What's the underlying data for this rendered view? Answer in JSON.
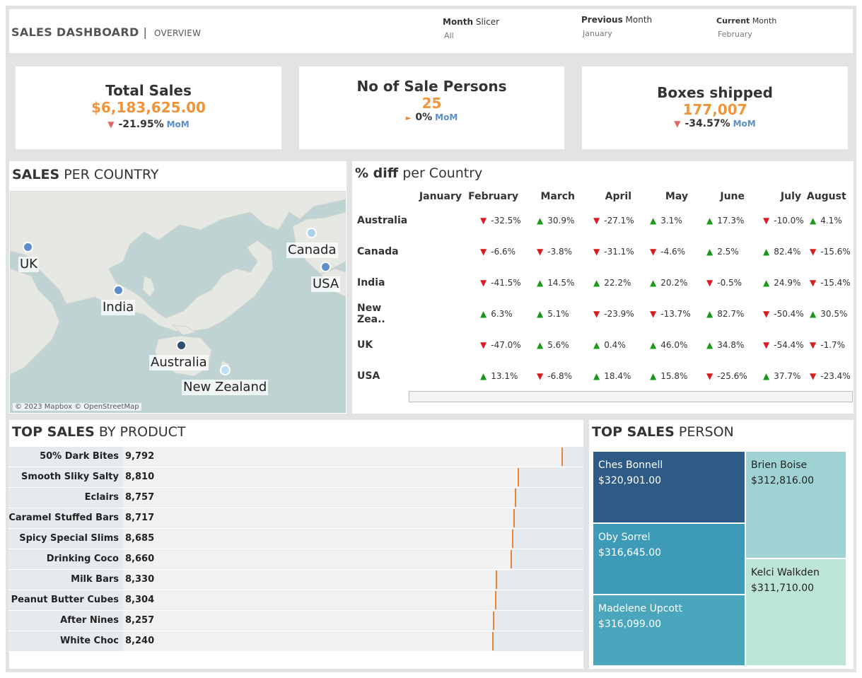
{
  "header": {
    "title": "SALES DASHBOARD",
    "sep": "|",
    "subtitle": "OVERVIEW"
  },
  "slicers": [
    {
      "bold": "Month",
      "label": "Slicer",
      "value": "All"
    },
    {
      "bold": "Previous",
      "label": "Month",
      "value": "January"
    },
    {
      "bold": "Current",
      "label": "Month",
      "value": "February"
    }
  ],
  "kpis": [
    {
      "title": "Total Sales",
      "value": "$6,183,625.00",
      "arrow": "▼",
      "pct": "-21.95%",
      "mom": "MoM"
    },
    {
      "title": "No of Sale Persons",
      "value": "25",
      "arrow": "►",
      "pct": "0%",
      "mom": "MoM"
    },
    {
      "title": "Boxes shipped",
      "value": "177,007",
      "arrow": "▼",
      "pct": "-34.57%",
      "mom": "MoM"
    }
  ],
  "map": {
    "title_bold": "SALES",
    "title_rest": "PER COUNTRY",
    "attribution": "© 2023 Mapbox © OpenStreetMap",
    "points": [
      {
        "name": "UK",
        "color": "#5b8fc7"
      },
      {
        "name": "Canada",
        "color": "#a9d2ec"
      },
      {
        "name": "USA",
        "color": "#5b8fc7"
      },
      {
        "name": "India",
        "color": "#5b8fc7"
      },
      {
        "name": "Australia",
        "color": "#2c4f73"
      },
      {
        "name": "New Zealand",
        "color": "#bcdff1"
      }
    ]
  },
  "diff": {
    "title_bold": "% diff",
    "title_rest": "per Country",
    "months": [
      "January",
      "February",
      "March",
      "April",
      "May",
      "June",
      "July",
      "August"
    ],
    "rows": [
      {
        "country": "Australia",
        "vals": [
          "",
          "-32.5%",
          "30.9%",
          "-27.1%",
          "3.1%",
          "17.3%",
          "-10.0%",
          "4.1%"
        ]
      },
      {
        "country": "Canada",
        "vals": [
          "",
          "-6.6%",
          "-3.8%",
          "-31.1%",
          "-4.6%",
          "2.5%",
          "82.4%",
          "-15.6%"
        ]
      },
      {
        "country": "India",
        "vals": [
          "",
          "-41.5%",
          "14.5%",
          "22.2%",
          "20.2%",
          "-0.5%",
          "24.9%",
          "-15.4%"
        ]
      },
      {
        "country": "New Zea..",
        "vals": [
          "",
          "6.3%",
          "5.1%",
          "-23.9%",
          "-13.7%",
          "82.7%",
          "-50.4%",
          "30.5%"
        ]
      },
      {
        "country": "UK",
        "vals": [
          "",
          "-47.0%",
          "5.6%",
          "0.4%",
          "46.0%",
          "34.8%",
          "-54.4%",
          "-1.7%"
        ]
      },
      {
        "country": "USA",
        "vals": [
          "",
          "13.1%",
          "-6.8%",
          "18.4%",
          "15.8%",
          "-25.6%",
          "37.7%",
          "-23.4%"
        ]
      }
    ]
  },
  "products": {
    "title_bold": "TOP SALES",
    "title_rest": "BY PRODUCT",
    "max": 9792,
    "items": [
      {
        "name": "50% Dark Bites",
        "value": 9792,
        "label": "9,792"
      },
      {
        "name": "Smooth Sliky Salty",
        "value": 8810,
        "label": "8,810"
      },
      {
        "name": "Eclairs",
        "value": 8757,
        "label": "8,757"
      },
      {
        "name": "Caramel Stuffed Bars",
        "value": 8717,
        "label": "8,717"
      },
      {
        "name": "Spicy Special Slims",
        "value": 8685,
        "label": "8,685"
      },
      {
        "name": "Drinking Coco",
        "value": 8660,
        "label": "8,660"
      },
      {
        "name": "Milk Bars",
        "value": 8330,
        "label": "8,330"
      },
      {
        "name": "Peanut Butter Cubes",
        "value": 8304,
        "label": "8,304"
      },
      {
        "name": "After Nines",
        "value": 8257,
        "label": "8,257"
      },
      {
        "name": "White Choc",
        "value": 8240,
        "label": "8,240"
      }
    ]
  },
  "persons": {
    "title_bold": "TOP SALES",
    "title_rest": "PERSON",
    "items": [
      {
        "name": "Ches Bonnell",
        "value": "$320,901.00",
        "color": "#2e5b86"
      },
      {
        "name": "Brien Boise",
        "value": "$312,816.00",
        "color": "#9fd3d3"
      },
      {
        "name": "Oby Sorrel",
        "value": "$316,645.00",
        "color": "#3e9bb7"
      },
      {
        "name": "Kelci Walkden",
        "value": "$311,710.00",
        "color": "#bde4d8"
      },
      {
        "name": "Madelene Upcott",
        "value": "$316,099.00",
        "color": "#4aa6bc"
      }
    ]
  }
}
